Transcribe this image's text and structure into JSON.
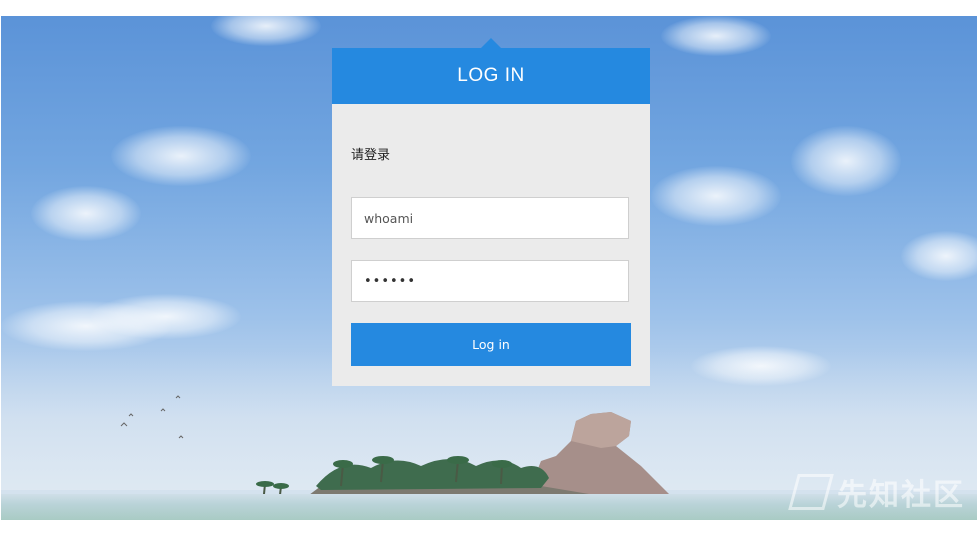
{
  "login": {
    "title": "LOG IN",
    "prompt": "请登录",
    "username_value": "whoami",
    "password_value": "••••••",
    "submit_label": "Log in"
  },
  "watermark": {
    "text": "先知社区"
  },
  "colors": {
    "accent": "#2589e0",
    "panel_bg": "#ebebeb",
    "sky_top": "#5b93d8",
    "sky_bottom": "#d8e4ee"
  },
  "icons": {
    "watermark_logo": "xianzhi-logo-icon"
  }
}
